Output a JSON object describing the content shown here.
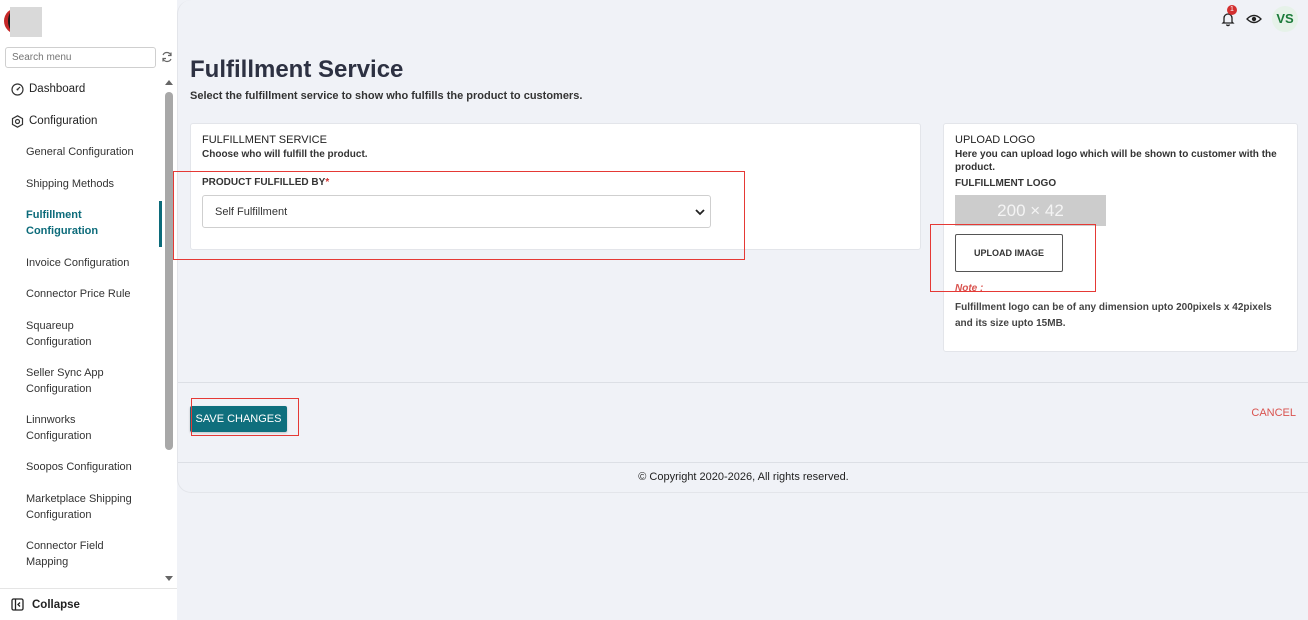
{
  "sidebar": {
    "search_placeholder": "Search menu",
    "items": [
      {
        "label": "Dashboard",
        "icon": "dashboard-icon"
      },
      {
        "label": "Configuration",
        "icon": "settings-icon"
      },
      {
        "label": "General Configuration"
      },
      {
        "label": "Shipping Methods"
      },
      {
        "label": "Fulfillment Configuration",
        "active": true
      },
      {
        "label": "Invoice Configuration"
      },
      {
        "label": "Connector Price Rule"
      },
      {
        "label": "Squareup Configuration"
      },
      {
        "label": "Seller Sync App Configuration"
      },
      {
        "label": "Linnworks Configuration"
      },
      {
        "label": "Soopos Configuration"
      },
      {
        "label": "Marketplace Shipping Configuration"
      },
      {
        "label": "Connector Field Mapping"
      }
    ],
    "collapse_label": "Collapse"
  },
  "header": {
    "notification_count": "1",
    "avatar_initials": "VS"
  },
  "page": {
    "title": "Fulfillment Service",
    "subtitle": "Select the fulfillment service to show who fulfills the product to customers."
  },
  "service_card": {
    "title": "FULFILLMENT SERVICE",
    "description": "Choose who will fulfill the product.",
    "field_label": "PRODUCT FULFILLED BY",
    "required_mark": "*",
    "selected_value": "Self Fulfillment"
  },
  "logo_card": {
    "title": "UPLOAD LOGO",
    "description": "Here you can upload logo which will be shown to customer with the product.",
    "field_label": "FULFILLMENT LOGO",
    "placeholder_text": "200 × 42",
    "upload_label": "UPLOAD IMAGE",
    "note_title": "Note :",
    "note_text": "Fulfillment logo can be of any dimension upto 200pixels x 42pixels and its size upto 15MB."
  },
  "actions": {
    "save_label": "SAVE CHANGES",
    "cancel_label": "CANCEL"
  },
  "footer": {
    "copyright": "© Copyright 2020-2026, All rights reserved."
  },
  "colors": {
    "accent": "#0f6f7d",
    "danger": "#d9534f",
    "highlight": "#e53935",
    "background": "#f0f2f7"
  }
}
